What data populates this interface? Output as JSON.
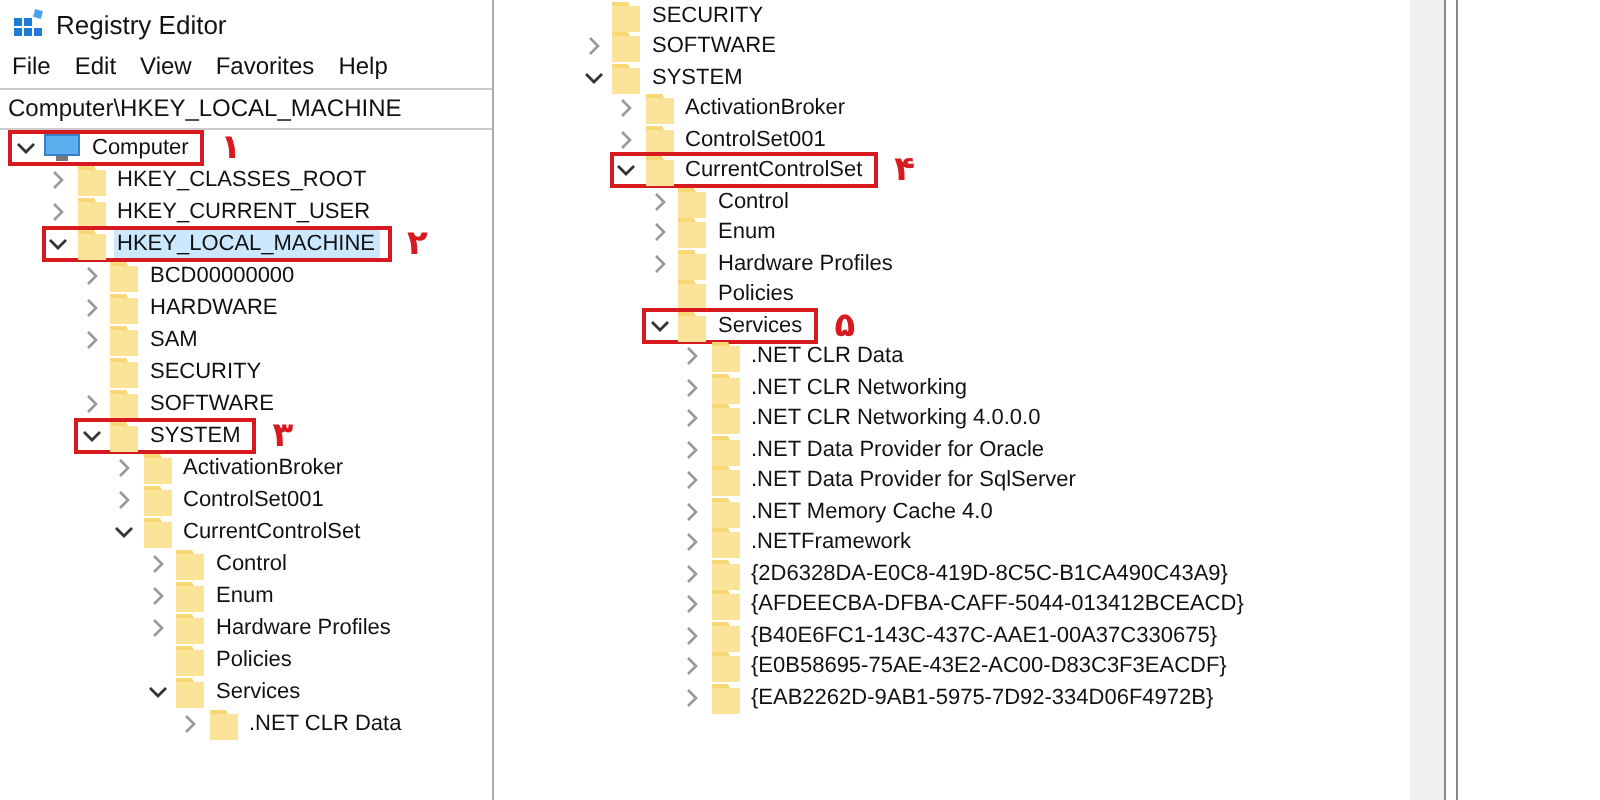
{
  "left_window": {
    "title": "Registry Editor",
    "menu": [
      "File",
      "Edit",
      "View",
      "Favorites",
      "Help"
    ],
    "address": "Computer\\HKEY_LOCAL_MACHINE",
    "tree": [
      {
        "label": "Computer",
        "kind": "computer",
        "expanded": true,
        "selected": false,
        "callout": "۱",
        "children": [
          {
            "label": "HKEY_CLASSES_ROOT",
            "kind": "folder",
            "expanded": false,
            "selected": false
          },
          {
            "label": "HKEY_CURRENT_USER",
            "kind": "folder",
            "expanded": false,
            "selected": false
          },
          {
            "label": "HKEY_LOCAL_MACHINE",
            "kind": "folder",
            "expanded": true,
            "selected": true,
            "callout": "۲",
            "children": [
              {
                "label": "BCD00000000",
                "kind": "folder",
                "expanded": false,
                "selected": false
              },
              {
                "label": "HARDWARE",
                "kind": "folder",
                "expanded": false,
                "selected": false
              },
              {
                "label": "SAM",
                "kind": "folder",
                "expanded": false,
                "selected": false
              },
              {
                "label": "SECURITY",
                "kind": "folder",
                "selected": false
              },
              {
                "label": "SOFTWARE",
                "kind": "folder",
                "expanded": false,
                "selected": false
              },
              {
                "label": "SYSTEM",
                "kind": "folder",
                "expanded": true,
                "selected": false,
                "callout": "۳",
                "children": [
                  {
                    "label": "ActivationBroker",
                    "kind": "folder",
                    "expanded": false,
                    "selected": false
                  },
                  {
                    "label": "ControlSet001",
                    "kind": "folder",
                    "expanded": false,
                    "selected": false
                  },
                  {
                    "label": "CurrentControlSet",
                    "kind": "folder",
                    "expanded": true,
                    "selected": false,
                    "children": [
                      {
                        "label": "Control",
                        "kind": "folder",
                        "expanded": false,
                        "selected": false
                      },
                      {
                        "label": "Enum",
                        "kind": "folder",
                        "expanded": false,
                        "selected": false
                      },
                      {
                        "label": "Hardware Profiles",
                        "kind": "folder",
                        "expanded": false,
                        "selected": false
                      },
                      {
                        "label": "Policies",
                        "kind": "folder",
                        "selected": false
                      },
                      {
                        "label": "Services",
                        "kind": "folder",
                        "expanded": true,
                        "selected": false,
                        "children": [
                          {
                            "label": ".NET CLR Data",
                            "kind": "folder",
                            "expanded": false,
                            "selected": false
                          }
                        ]
                      }
                    ]
                  }
                ]
              }
            ]
          }
        ]
      }
    ]
  },
  "right_window": {
    "tree": [
      {
        "label": "SECURITY",
        "kind": "folder",
        "selected": false
      },
      {
        "label": "SOFTWARE",
        "kind": "folder",
        "expanded": false,
        "selected": false
      },
      {
        "label": "SYSTEM",
        "kind": "folder",
        "expanded": true,
        "selected": false,
        "children": [
          {
            "label": "ActivationBroker",
            "kind": "folder",
            "expanded": false,
            "selected": false
          },
          {
            "label": "ControlSet001",
            "kind": "folder",
            "expanded": false,
            "selected": false
          },
          {
            "label": "CurrentControlSet",
            "kind": "folder",
            "expanded": true,
            "selected": false,
            "callout": "۴",
            "children": [
              {
                "label": "Control",
                "kind": "folder",
                "expanded": false,
                "selected": false
              },
              {
                "label": "Enum",
                "kind": "folder",
                "expanded": false,
                "selected": false
              },
              {
                "label": "Hardware Profiles",
                "kind": "folder",
                "expanded": false,
                "selected": false
              },
              {
                "label": "Policies",
                "kind": "folder",
                "selected": false
              },
              {
                "label": "Services",
                "kind": "folder",
                "expanded": true,
                "selected": false,
                "callout": "۵",
                "children": [
                  {
                    "label": ".NET CLR Data",
                    "kind": "folder",
                    "expanded": false,
                    "selected": false
                  },
                  {
                    "label": ".NET CLR Networking",
                    "kind": "folder",
                    "expanded": false,
                    "selected": false
                  },
                  {
                    "label": ".NET CLR Networking 4.0.0.0",
                    "kind": "folder",
                    "expanded": false,
                    "selected": false
                  },
                  {
                    "label": ".NET Data Provider for Oracle",
                    "kind": "folder",
                    "expanded": false,
                    "selected": false
                  },
                  {
                    "label": ".NET Data Provider for SqlServer",
                    "kind": "folder",
                    "expanded": false,
                    "selected": false
                  },
                  {
                    "label": ".NET Memory Cache 4.0",
                    "kind": "folder",
                    "expanded": false,
                    "selected": false
                  },
                  {
                    "label": ".NETFramework",
                    "kind": "folder",
                    "expanded": false,
                    "selected": false
                  },
                  {
                    "label": "{2D6328DA-E0C8-419D-8C5C-B1CA490C43A9}",
                    "kind": "folder",
                    "expanded": false,
                    "selected": false
                  },
                  {
                    "label": "{AFDEECBA-DFBA-CAFF-5044-013412BCEACD}",
                    "kind": "folder",
                    "expanded": false,
                    "selected": false
                  },
                  {
                    "label": "{B40E6FC1-143C-437C-AAE1-00A37C330675}",
                    "kind": "folder",
                    "expanded": false,
                    "selected": false
                  },
                  {
                    "label": "{E0B58695-75AE-43E2-AC00-D83C3F3EACDF}",
                    "kind": "folder",
                    "expanded": false,
                    "selected": false
                  },
                  {
                    "label": "{EAB2262D-9AB1-5975-7D92-334D06F4972B}",
                    "kind": "folder",
                    "expanded": false,
                    "selected": false
                  }
                ]
              }
            ]
          }
        ]
      }
    ]
  }
}
